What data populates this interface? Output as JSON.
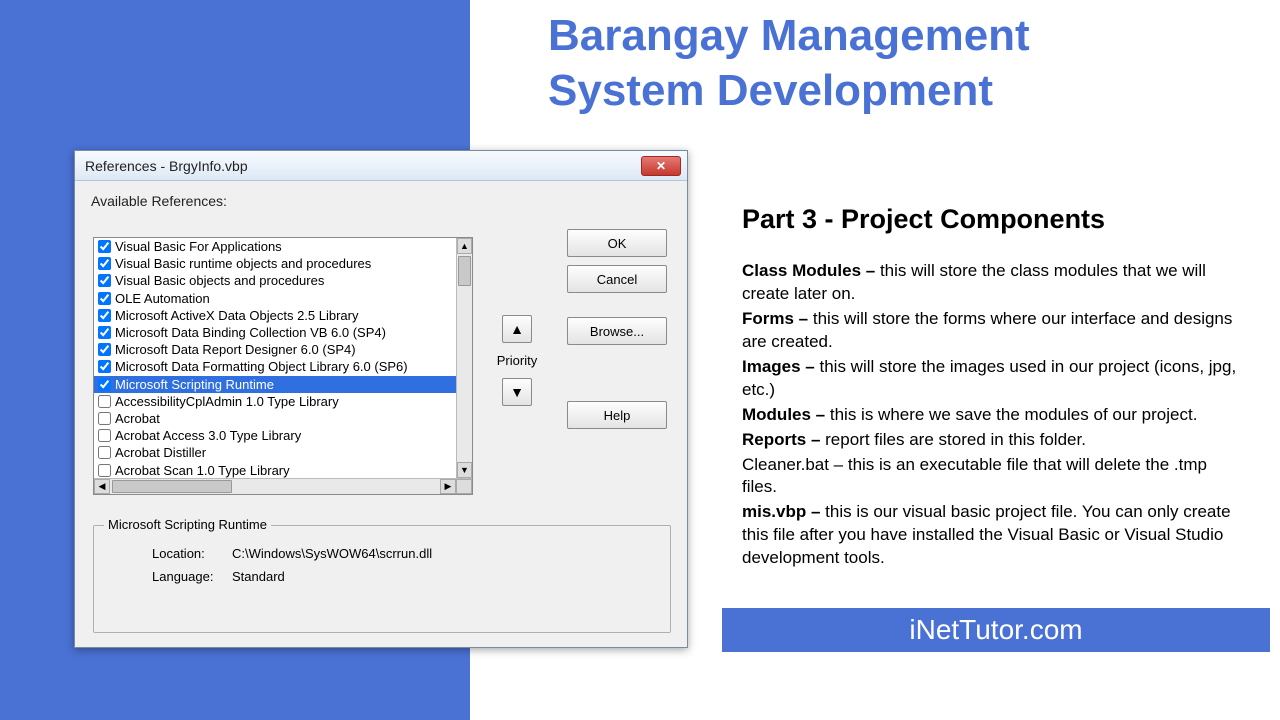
{
  "slide": {
    "title_line1": "Barangay Management",
    "title_line2": "System Development",
    "subtitle": "Part 3 - Project Components",
    "footer": "iNetTutor.com"
  },
  "content": {
    "items": [
      {
        "label": "Class Modules – ",
        "text": "this will store the class modules that we will create later on."
      },
      {
        "label": "Forms – ",
        "text": "this will store the forms where our interface and designs are created."
      },
      {
        "label": "Images – ",
        "text": "this will store the images used in our project (icons, jpg, etc.)"
      },
      {
        "label": "Modules – ",
        "text": "this is where we save the modules of our project."
      },
      {
        "label": "Reports – ",
        "text": "report files are stored in this folder."
      },
      {
        "label": "",
        "text": "Cleaner.bat – this is an executable file that will delete the .tmp files."
      },
      {
        "label": "mis.vbp – ",
        "text": "this is our visual basic project file. You can only create this file after you have installed the Visual Basic or Visual Studio development tools."
      }
    ]
  },
  "dialog": {
    "title": "References - BrgyInfo.vbp",
    "close": "✕",
    "avail_label": "Available References:",
    "ok": "OK",
    "cancel": "Cancel",
    "browse": "Browse...",
    "help": "Help",
    "priority_label": "Priority",
    "up": "▲",
    "down": "▼",
    "refs": [
      {
        "checked": true,
        "label": "Visual Basic For Applications",
        "selected": false
      },
      {
        "checked": true,
        "label": "Visual Basic runtime objects and procedures",
        "selected": false
      },
      {
        "checked": true,
        "label": "Visual Basic objects and procedures",
        "selected": false
      },
      {
        "checked": true,
        "label": "OLE Automation",
        "selected": false
      },
      {
        "checked": true,
        "label": "Microsoft ActiveX Data Objects 2.5 Library",
        "selected": false
      },
      {
        "checked": true,
        "label": "Microsoft Data Binding Collection VB 6.0 (SP4)",
        "selected": false
      },
      {
        "checked": true,
        "label": "Microsoft Data Report Designer 6.0 (SP4)",
        "selected": false
      },
      {
        "checked": true,
        "label": "Microsoft Data Formatting Object Library 6.0 (SP6)",
        "selected": false
      },
      {
        "checked": true,
        "label": "Microsoft Scripting Runtime",
        "selected": true
      },
      {
        "checked": false,
        "label": "AccessibilityCplAdmin 1.0 Type Library",
        "selected": false
      },
      {
        "checked": false,
        "label": "Acrobat",
        "selected": false
      },
      {
        "checked": false,
        "label": "Acrobat Access 3.0 Type Library",
        "selected": false
      },
      {
        "checked": false,
        "label": "Acrobat Distiller",
        "selected": false
      },
      {
        "checked": false,
        "label": "Acrobat Scan 1.0 Type Library",
        "selected": false
      }
    ],
    "group_title": "Microsoft Scripting Runtime",
    "location_label": "Location:",
    "location_val": "C:\\Windows\\SysWOW64\\scrrun.dll",
    "language_label": "Language:",
    "language_val": "Standard"
  }
}
